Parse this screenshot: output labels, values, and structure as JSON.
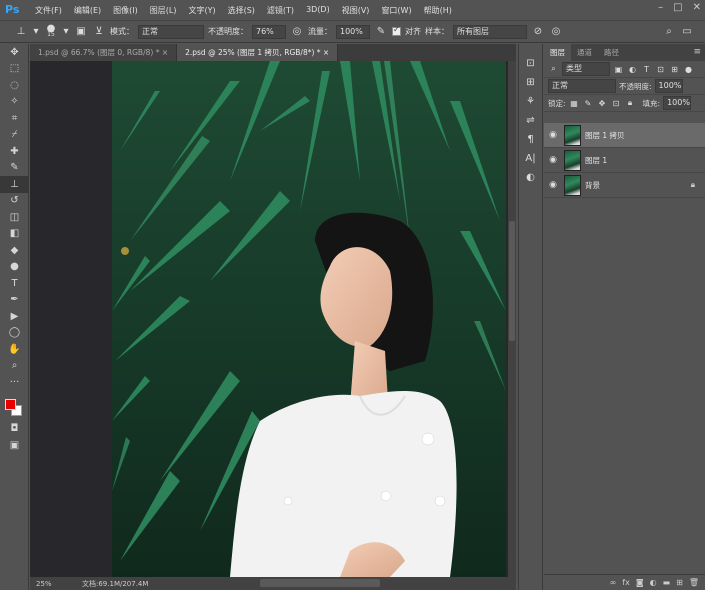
{
  "app": {
    "logo": "Ps"
  },
  "menu": [
    "文件(F)",
    "编辑(E)",
    "图像(I)",
    "图层(L)",
    "文字(Y)",
    "选择(S)",
    "滤镜(T)",
    "3D(D)",
    "视图(V)",
    "窗口(W)",
    "帮助(H)"
  ],
  "options": {
    "brush_size": "15",
    "mode_label": "模式：",
    "mode_value": "正常",
    "opacity_label": "不透明度：",
    "opacity_value": "76%",
    "flow_label": "流量：",
    "flow_value": "100%",
    "align_label": "对齐",
    "sample_label": "样本：",
    "sample_value": "所有图层"
  },
  "tabs": [
    {
      "label": "1.psd @ 66.7% (图层 0, RGB/8) * ×"
    },
    {
      "label": "2.psd @ 25% (图层 1 拷贝, RGB/8*) * ×"
    }
  ],
  "status": {
    "zoom": "25%",
    "doc": "文档:69.1M/207.4M"
  },
  "panel": {
    "tabs": [
      "图层",
      "通道",
      "路径"
    ],
    "filter_kind": "类型",
    "blend_mode": "正常",
    "opacity_label": "不透明度:",
    "opacity_value": "100%",
    "lock_label": "锁定:",
    "fill_label": "填充:",
    "fill_value": "100%",
    "layers": [
      {
        "name": "图层 1 拷贝"
      },
      {
        "name": "图层 1"
      },
      {
        "name": "背景"
      }
    ]
  },
  "colors": {
    "foreground": "#e80000",
    "background": "#ffffff",
    "accent": "#31a8ff"
  }
}
